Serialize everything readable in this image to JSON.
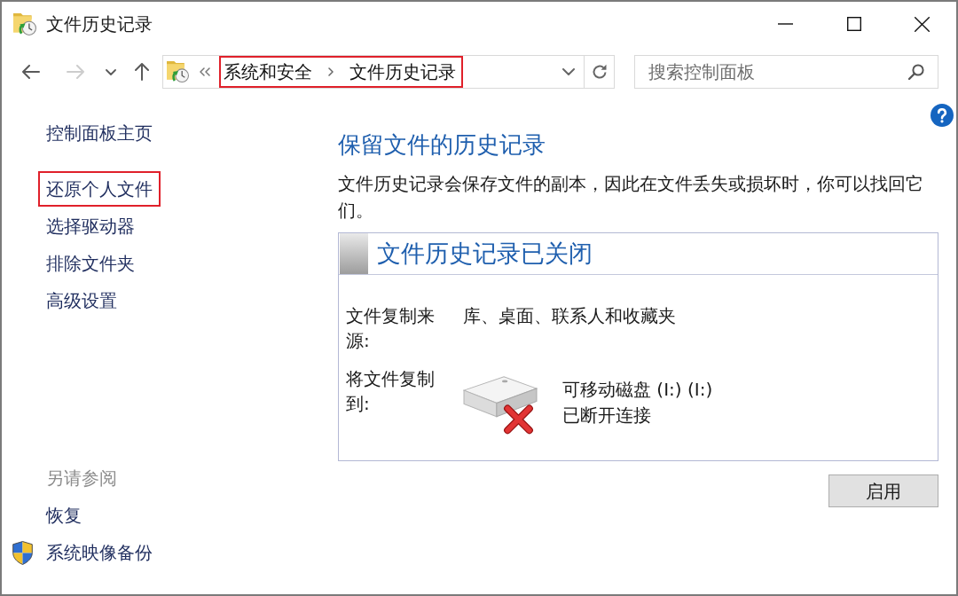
{
  "window": {
    "title": "文件历史记录"
  },
  "navigation": {
    "buttons": [
      {
        "kind": "back",
        "disabled": false
      },
      {
        "kind": "forward",
        "disabled": true
      },
      {
        "kind": "recent",
        "disabled": false
      },
      {
        "kind": "up",
        "disabled": false
      }
    ],
    "address": {
      "highlighted": true,
      "breadcrumbs": [
        "系统和安全",
        "文件历史记录"
      ]
    },
    "search": {
      "placeholder": "搜索控制面板"
    }
  },
  "sidebar": {
    "items": [
      {
        "label": "控制面板主页",
        "highlighted": false
      },
      {
        "label": "还原个人文件",
        "highlighted": true
      },
      {
        "label": "选择驱动器",
        "highlighted": false
      },
      {
        "label": "排除文件夹",
        "highlighted": false
      },
      {
        "label": "高级设置",
        "highlighted": false
      }
    ],
    "see_also": {
      "title": "另请参阅",
      "items": [
        {
          "label": "恢复",
          "kind": "plain"
        },
        {
          "label": "系统映像备份",
          "kind": "shield"
        }
      ]
    }
  },
  "main": {
    "title": "保留文件的历史记录",
    "description": "文件历史记录会保存文件的副本，因此在文件丢失或损坏时，你可以找回它们。",
    "status_panel": {
      "on": false,
      "title": "文件历史记录已关闭",
      "rows": [
        {
          "kind": "text",
          "label": "文件复制来源:",
          "value": "库、桌面、联系人和收藏夹"
        },
        {
          "kind": "drive",
          "label": "将文件复制到:",
          "drive_name": "可移动磁盘 (I:) (I:)",
          "drive_status": "已断开连接",
          "connected": false
        }
      ]
    },
    "enable_button": "启用"
  }
}
